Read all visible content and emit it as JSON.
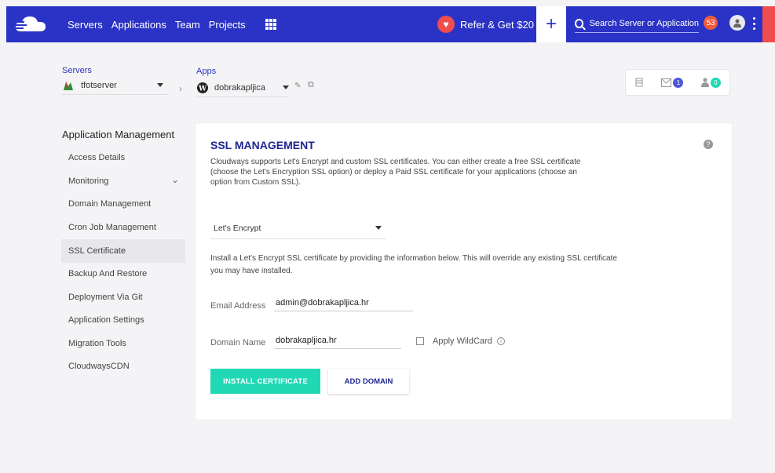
{
  "nav": {
    "links": [
      "Servers",
      "Applications",
      "Team",
      "Projects"
    ],
    "refer_label": "Refer & Get $20",
    "search_placeholder": "Search Server or Application",
    "notification_count": "53"
  },
  "breadcrumb": {
    "servers_label": "Servers",
    "server_name": "tfotserver",
    "apps_label": "Apps",
    "app_name": "dobrakapljica"
  },
  "widgets": {
    "mail_count": "1",
    "user_count": "0"
  },
  "sidebar": {
    "title": "Application Management",
    "items": [
      {
        "label": "Access Details"
      },
      {
        "label": "Monitoring"
      },
      {
        "label": "Domain Management"
      },
      {
        "label": "Cron Job Management"
      },
      {
        "label": "SSL Certificate"
      },
      {
        "label": "Backup And Restore"
      },
      {
        "label": "Deployment Via Git"
      },
      {
        "label": "Application Settings"
      },
      {
        "label": "Migration Tools"
      },
      {
        "label": "CloudwaysCDN"
      }
    ],
    "active_index": 4
  },
  "ssl": {
    "title": "SSL MANAGEMENT",
    "description": "Cloudways supports Let's Encrypt and custom SSL certificates. You can either create a free SSL certificate (choose the Let's Encryption SSL option) or deploy a Paid SSL certificate for your applications (choose an option from Custom SSL).",
    "selected_option": "Let's Encrypt",
    "install_note": "Install a Let's Encrypt SSL certificate by providing the information below. This will override any existing SSL certificate you may have installed.",
    "email_label": "Email Address",
    "email_value": "admin@dobrakapljica.hr",
    "domain_label": "Domain Name",
    "domain_value": "dobrakapljica.hr",
    "wildcard_label": "Apply WildCard",
    "wildcard_checked": false,
    "install_button": "INSTALL CERTIFICATE",
    "add_domain_button": "ADD DOMAIN"
  },
  "colors": {
    "brand": "#2b33c6",
    "accent": "#21d8b5",
    "title": "#1e2690",
    "alert": "#f05a3c"
  }
}
